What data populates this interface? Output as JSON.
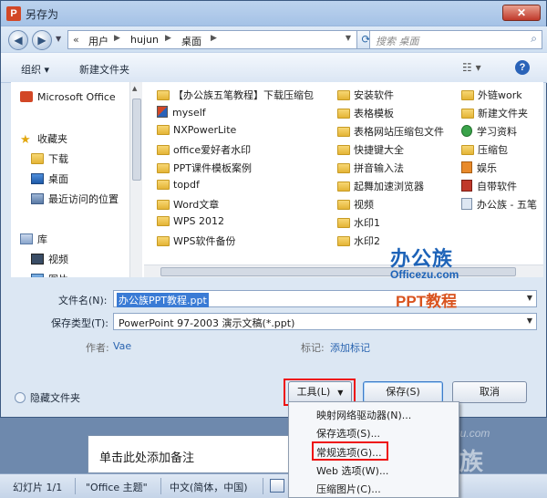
{
  "window": {
    "title": "另存为",
    "close_glyph": "✕",
    "app_icon_glyph": "P"
  },
  "address": {
    "prefix": "«",
    "crumbs": [
      "用户",
      "hujun",
      "桌面"
    ],
    "search_placeholder": "搜索 桌面"
  },
  "toolbar": {
    "organize": "组织 ▾",
    "new_folder": "新建文件夹",
    "help": "?"
  },
  "nav": {
    "items": [
      {
        "label": "Microsoft Office",
        "icon": "office-icon"
      },
      {
        "label": "收藏夹",
        "icon": "star-icon"
      },
      {
        "label": "下载",
        "icon": "download-folder-icon"
      },
      {
        "label": "桌面",
        "icon": "desktop-icon"
      },
      {
        "label": "最近访问的位置",
        "icon": "recent-places-icon"
      },
      {
        "label": "库",
        "icon": "library-icon"
      },
      {
        "label": "视频",
        "icon": "video-icon"
      },
      {
        "label": "图片",
        "icon": "pictures-icon"
      }
    ]
  },
  "files": {
    "col1": [
      "【办公族五笔教程】下载压缩包",
      "myself",
      "NXPowerLite",
      "office爱好者水印",
      "PPT课件模板案例",
      "topdf",
      "Word文章",
      "WPS 2012",
      "WPS软件备份"
    ],
    "col2": [
      "安装软件",
      "表格模板",
      "表格网站压缩包文件",
      "快捷键大全",
      "拼音输入法",
      "起舞加速浏览器",
      "视频",
      "水印1",
      "水印2"
    ],
    "col3": [
      "外链work",
      "新建文件夹",
      "学习资料",
      "压缩包",
      "娱乐",
      "自带软件",
      "办公族 - 五笔"
    ]
  },
  "watermark": {
    "logo": "办公族",
    "site": "Officezu.com",
    "tag": "PPT教程"
  },
  "form": {
    "filename_label": "文件名(N):",
    "filename_value": "办公族PPT教程.ppt",
    "type_label": "保存类型(T):",
    "type_value": "PowerPoint 97-2003 演示文稿(*.ppt)",
    "author_label": "作者:",
    "author_value": "Vae",
    "tags_label": "标记:",
    "tags_value": "添加标记"
  },
  "buttons": {
    "hide_folders": "隐藏文件夹",
    "tools": "工具(L)",
    "save": "保存(S)",
    "cancel": "取消"
  },
  "tools_menu": [
    "映射网络驱动器(N)...",
    "保存选项(S)...",
    "常规选项(G)...",
    "Web 选项(W)...",
    "压缩图片(C)..."
  ],
  "ppt": {
    "notes_placeholder": "单击此处添加备注",
    "status_slide": "幻灯片 1/1",
    "status_theme": "\"Office 主题\"",
    "status_lang": "中文(简体，中国)"
  },
  "watermark_bottom": {
    "site_italic": "officezu.com",
    "brand": "办公族"
  }
}
